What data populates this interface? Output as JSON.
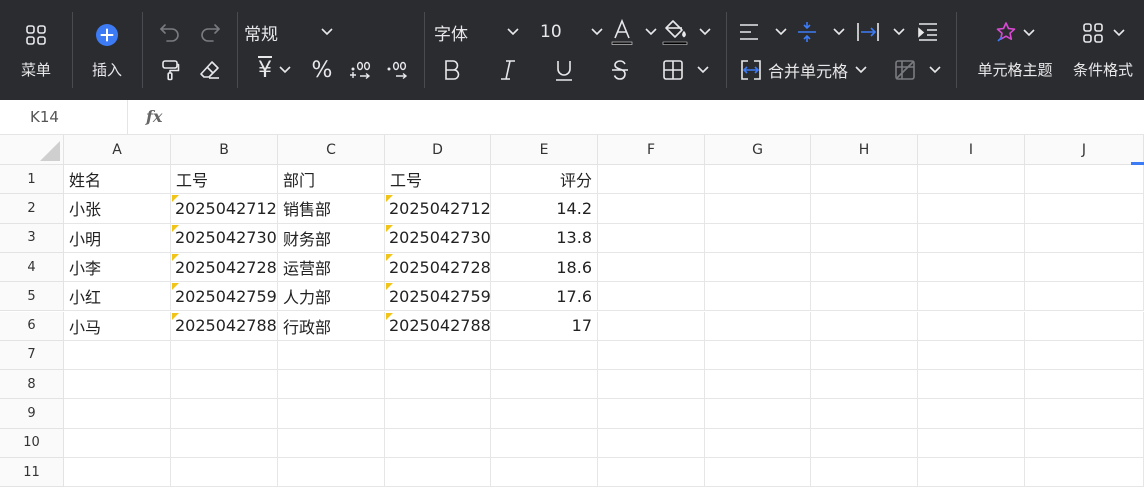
{
  "toolbar": {
    "menu_label": "菜单",
    "insert_label": "插入",
    "number_format": "常规",
    "font_name": "字体",
    "font_size": "10",
    "currency_symbol": "¥",
    "percent_symbol": "%",
    "merge_label": "合并单元格",
    "cell_theme_label": "单元格主题",
    "conditional_format_label": "条件格式",
    "font_color": "#111111",
    "fill_color": "#000000"
  },
  "formula_bar": {
    "cell_ref": "K14",
    "fx_label": "fx",
    "value": ""
  },
  "sheet": {
    "columns": [
      "A",
      "B",
      "C",
      "D",
      "E",
      "F",
      "G",
      "H",
      "I",
      "J"
    ],
    "row_numbers": [
      "1",
      "2",
      "3",
      "4",
      "5",
      "6",
      "7",
      "8",
      "9",
      "10",
      "11"
    ],
    "cells": [
      [
        "姓名",
        "工号",
        "部门",
        "工号",
        "评分"
      ],
      [
        "小张",
        "2025042712",
        "销售部",
        "2025042712",
        "14.2"
      ],
      [
        "小明",
        "2025042730",
        "财务部",
        "2025042730",
        "13.8"
      ],
      [
        "小李",
        "2025042728",
        "运营部",
        "2025042728",
        "18.6"
      ],
      [
        "小红",
        "2025042759",
        "人力部",
        "2025042759",
        "17.6"
      ],
      [
        "小马",
        "2025042788",
        "行政部",
        "2025042788",
        "17"
      ]
    ],
    "text_number_flag_color": "#f0c419"
  }
}
